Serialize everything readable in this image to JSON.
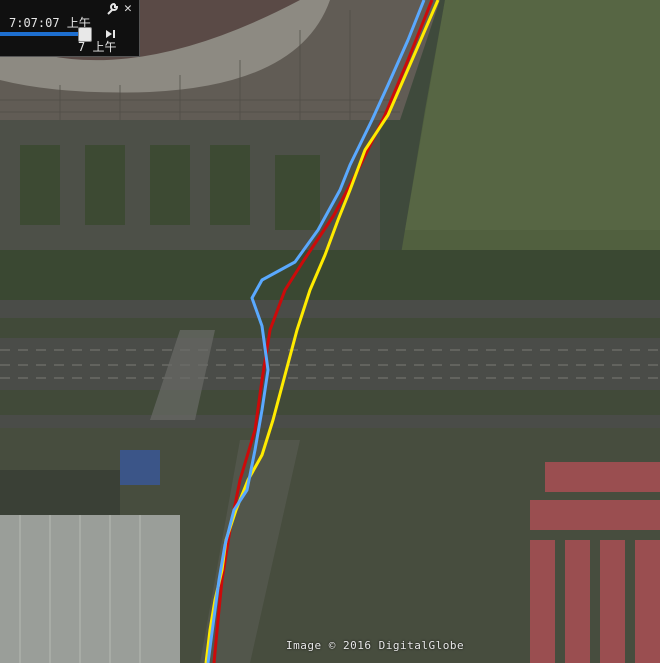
{
  "timebar": {
    "start_time": "7:07:07 上午",
    "end_time": "7 上午",
    "slider_position": 0.88
  },
  "imagery_credit": "Image © 2016 DigitalGlobe",
  "tracks": [
    {
      "color": "#5aa9ff"
    },
    {
      "color": "#ffeb00"
    },
    {
      "color": "#cc0a0a"
    }
  ],
  "icons": {
    "wrench": "wrench-icon",
    "close": "close-icon",
    "step_forward": "step-forward-icon"
  }
}
